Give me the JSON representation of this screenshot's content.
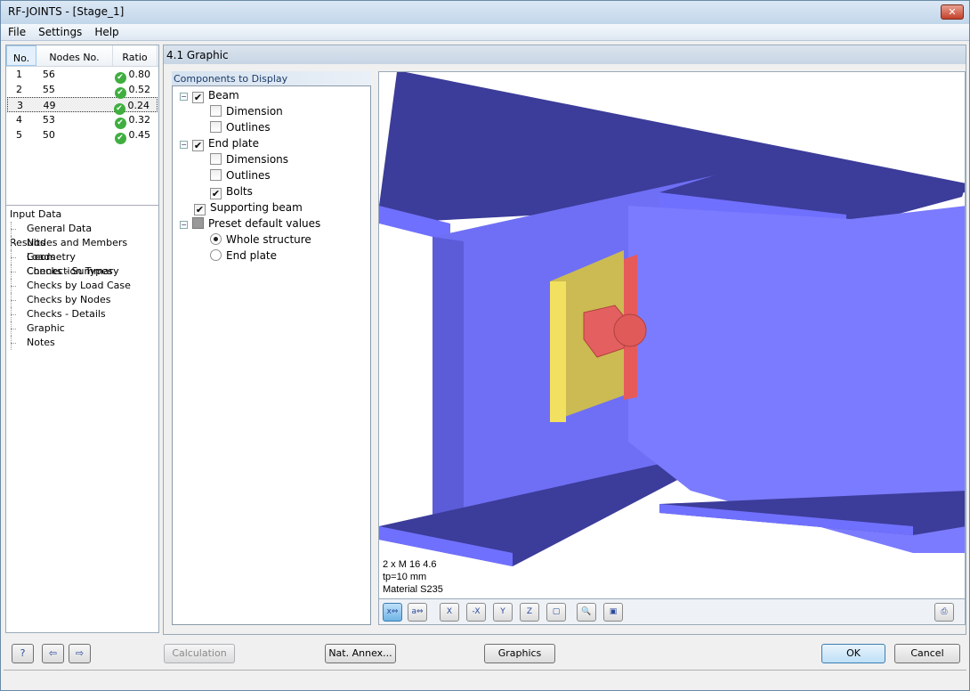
{
  "window": {
    "title": "RF-JOINTS - [Stage_1]",
    "close_icon": "close-icon"
  },
  "menu": [
    "File",
    "Settings",
    "Help"
  ],
  "table": {
    "headers": [
      "No.",
      "Nodes No.",
      "Ratio"
    ],
    "rows": [
      {
        "no": "1",
        "node": "56",
        "ratio": "0.80"
      },
      {
        "no": "2",
        "node": "55",
        "ratio": "0.52"
      },
      {
        "no": "3",
        "node": "49",
        "ratio": "0.24"
      },
      {
        "no": "4",
        "node": "53",
        "ratio": "0.32"
      },
      {
        "no": "5",
        "node": "50",
        "ratio": "0.45"
      }
    ],
    "selected_row": "3",
    "status_icon": "check-circle-icon",
    "status_color": "#3fae3f"
  },
  "nav": {
    "input_label": "Input Data",
    "input_items": [
      "General Data",
      "Nodes and Members",
      "Loads",
      "Connection Types"
    ],
    "results_label": "Results",
    "results_items": [
      "Geometry",
      "Checks - Summary",
      "Checks by Load Case",
      "Checks by Nodes",
      "Checks - Details",
      "Graphic",
      "Notes"
    ]
  },
  "panel": {
    "title": "4.1 Graphic",
    "components_title": "Components to Display",
    "tree": {
      "beam": "Beam",
      "beam_dimension": "Dimension",
      "beam_outlines": "Outlines",
      "end_plate": "End plate",
      "ep_dimensions": "Dimensions",
      "ep_outlines": "Outlines",
      "ep_bolts": "Bolts",
      "supporting_beam": "Supporting beam",
      "preset": "Preset default values",
      "whole": "Whole structure",
      "endplate_radio": "End plate"
    },
    "checked": {
      "beam": true,
      "beam_dimension": false,
      "beam_outlines": false,
      "end_plate": true,
      "ep_dimensions": false,
      "ep_outlines": false,
      "ep_bolts": true,
      "supporting_beam": true,
      "preset": "indeterminate",
      "radio": "Whole structure"
    }
  },
  "graphic": {
    "info": [
      "2 x M 16 4.6",
      "tp=10 mm",
      "Material S235"
    ],
    "colors": {
      "beam": "#7070ff",
      "beam_top": "#3c3c9a",
      "plate": "#e0d060",
      "bolt": "#e05a5a"
    }
  },
  "toolbar": [
    "x",
    "a",
    "X",
    "-X",
    "Y",
    "Z",
    "iso",
    "zoom",
    "render",
    "print"
  ],
  "buttons": {
    "calculation": "Calculation",
    "nat_annex": "Nat. Annex...",
    "graphics": "Graphics",
    "ok": "OK",
    "cancel": "Cancel"
  }
}
